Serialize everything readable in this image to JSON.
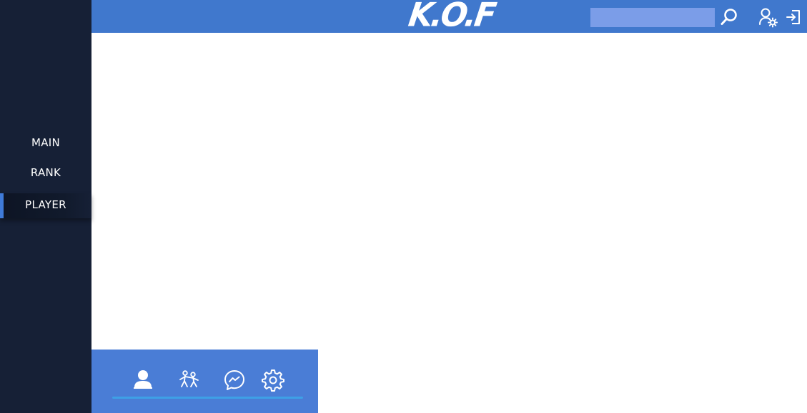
{
  "app": {
    "logo_text": "K.O.F"
  },
  "sidebar": {
    "items": [
      {
        "label": "MAIN",
        "active": false
      },
      {
        "label": "RANK",
        "active": false
      },
      {
        "label": "PLAYER",
        "active": true
      }
    ]
  },
  "header": {
    "search": {
      "value": "",
      "placeholder": ""
    },
    "icons": [
      "search-icon",
      "user-settings-icon",
      "logout-icon"
    ]
  },
  "bottom_panel": {
    "icons": [
      "profile-icon",
      "fight-icon",
      "messenger-icon",
      "settings-icon"
    ]
  },
  "colors": {
    "sidebar_bg": "#162036",
    "topbar_bg": "#4078cd",
    "search_bg": "#7b9de8",
    "panel_bg": "#4a7dd6",
    "accent": "#3f7ad8",
    "underline": "#3ea0e6"
  }
}
